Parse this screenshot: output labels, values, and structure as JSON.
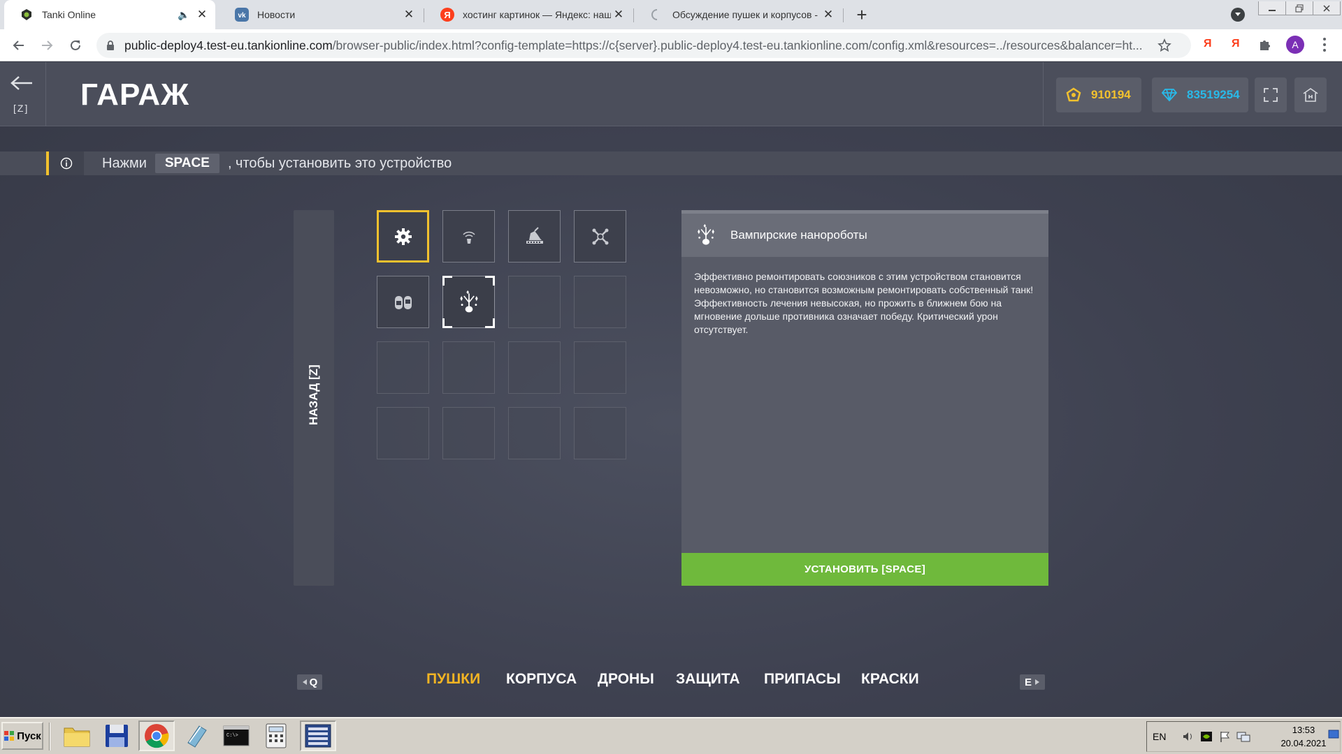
{
  "browser": {
    "tabs": [
      {
        "title": "Tanki Online",
        "favicon": "tank-icon",
        "audio": true,
        "active": true
      },
      {
        "title": "Новости",
        "favicon": "vk-icon"
      },
      {
        "title": "хостинг картинок — Яндекс: нашл",
        "favicon": "yandex-icon"
      },
      {
        "title": "Обсуждение пушек и корпусов - Т",
        "favicon": "loading-icon"
      }
    ],
    "url_host": "public-deploy4.test-eu.tankionline.com",
    "url_path": "/browser-public/index.html?config-template=https://c{server}.public-deploy4.test-eu.tankionline.com/config.xml&resources=../resources&balancer=ht...",
    "profile_initial": "A",
    "yandex_labels": [
      "Я",
      "Я"
    ]
  },
  "game": {
    "back_key": "[Z]",
    "title": "ГАРАЖ",
    "crystals": "910194",
    "tankoins": "83519254",
    "hint": {
      "before": "Нажми",
      "key": "SPACE",
      "after": ", чтобы установить это устройство"
    },
    "side_back_label": "НАЗАД [Z]",
    "slots": [
      {
        "icon": "gear-icon",
        "state": "active"
      },
      {
        "icon": "signal-drone-icon",
        "state": "item"
      },
      {
        "icon": "turret-device-icon",
        "state": "item"
      },
      {
        "icon": "crossed-bones-icon",
        "state": "item"
      },
      {
        "icon": "capsules-icon",
        "state": "item"
      },
      {
        "icon": "nanobots-icon",
        "state": "selected"
      },
      {
        "state": "empty"
      },
      {
        "state": "empty"
      },
      {
        "state": "empty"
      },
      {
        "state": "empty"
      },
      {
        "state": "empty"
      },
      {
        "state": "empty"
      },
      {
        "state": "empty"
      },
      {
        "state": "empty"
      },
      {
        "state": "empty"
      },
      {
        "state": "empty"
      }
    ],
    "detail": {
      "name": "Вампирские нанороботы",
      "description": "Эффективно ремонтировать союзников с этим устройством становится невозможно, но становится возможным ремонтировать собственный танк! Эффективность лечения невысокая, но прожить в ближнем бою на мгновение дольше противника означает победу. Критический урон отсутствует."
    },
    "install_button": "УСТАНОВИТЬ [SPACE]",
    "prev_key": "Q",
    "next_key": "E",
    "categories": [
      "ПУШКИ",
      "КОРПУСА",
      "ДРОНЫ",
      "ЗАЩИТА",
      "ПРИПАСЫ",
      "КРАСКИ"
    ],
    "active_category": 0,
    "colors": {
      "accent": "#f2b423",
      "install": "#6fb93c",
      "crystal": "#f2c12e",
      "tankoin": "#29b9e8"
    }
  },
  "taskbar": {
    "start_label": "Пуск",
    "apps": [
      "folder-icon",
      "floppy-save-icon",
      "chrome-icon",
      "notepad-icon",
      "terminal-icon",
      "calculator-icon",
      "window-list-icon"
    ],
    "lang": "EN",
    "time": "13:53",
    "date": "20.04.2021"
  }
}
